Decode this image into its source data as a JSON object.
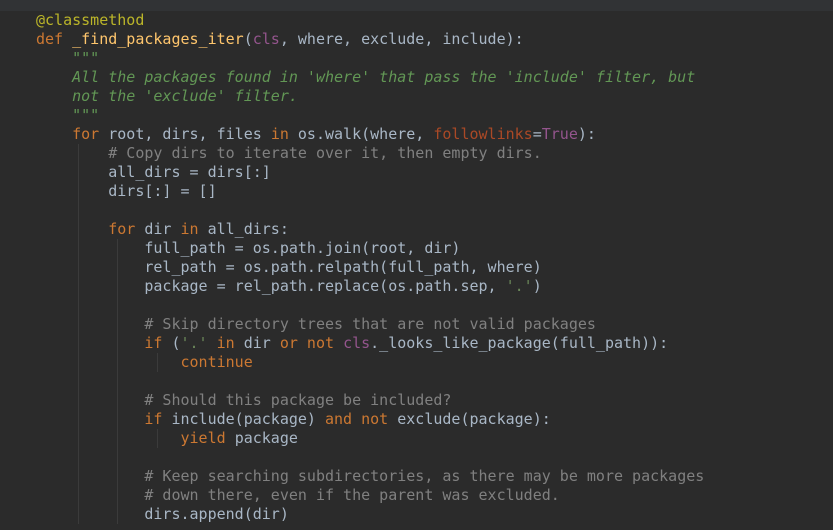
{
  "editor": {
    "theme_colors": {
      "background": "#2b2b2b",
      "keyword": "#cc7832",
      "function": "#ffc66d",
      "decorator": "#bbb529",
      "docstring": "#629755",
      "comment": "#808080",
      "string": "#6a8759",
      "self_param": "#94558d",
      "named_arg": "#aa4926",
      "default_text": "#a9b7c6"
    },
    "lines": [
      {
        "indent": 0,
        "tokens": [
          {
            "t": "deco",
            "v": "@classmethod"
          }
        ]
      },
      {
        "indent": 0,
        "tokens": [
          {
            "t": "kw",
            "v": "def "
          },
          {
            "t": "fn",
            "v": "_find_packages_iter"
          },
          {
            "t": "plain",
            "v": "("
          },
          {
            "t": "self",
            "v": "cls"
          },
          {
            "t": "plain",
            "v": ", where, exclude, include):"
          }
        ]
      },
      {
        "indent": 1,
        "tokens": [
          {
            "t": "doc",
            "v": "\"\"\""
          }
        ]
      },
      {
        "indent": 1,
        "tokens": [
          {
            "t": "doc",
            "v": "All the packages found in 'where' that pass the 'include' filter, but"
          }
        ]
      },
      {
        "indent": 1,
        "tokens": [
          {
            "t": "doc",
            "v": "not the 'exclude' filter."
          }
        ]
      },
      {
        "indent": 1,
        "tokens": [
          {
            "t": "doc",
            "v": "\"\"\""
          }
        ]
      },
      {
        "indent": 1,
        "tokens": [
          {
            "t": "kw",
            "v": "for "
          },
          {
            "t": "plain",
            "v": "root, dirs, files "
          },
          {
            "t": "kw",
            "v": "in "
          },
          {
            "t": "plain",
            "v": "os.walk(where, "
          },
          {
            "t": "param",
            "v": "followlinks"
          },
          {
            "t": "plain",
            "v": "="
          },
          {
            "t": "self",
            "v": "True"
          },
          {
            "t": "plain",
            "v": "):"
          }
        ]
      },
      {
        "indent": 2,
        "tokens": [
          {
            "t": "com",
            "v": "# Copy dirs to iterate over it, then empty dirs."
          }
        ]
      },
      {
        "indent": 2,
        "tokens": [
          {
            "t": "plain",
            "v": "all_dirs = dirs[:]"
          }
        ]
      },
      {
        "indent": 2,
        "tokens": [
          {
            "t": "plain",
            "v": "dirs[:] = []"
          }
        ]
      },
      {
        "indent": 2,
        "tokens": []
      },
      {
        "indent": 2,
        "tokens": [
          {
            "t": "kw",
            "v": "for "
          },
          {
            "t": "plain",
            "v": "dir "
          },
          {
            "t": "kw",
            "v": "in "
          },
          {
            "t": "plain",
            "v": "all_dirs:"
          }
        ]
      },
      {
        "indent": 3,
        "tokens": [
          {
            "t": "plain",
            "v": "full_path = os.path.join(root, dir)"
          }
        ]
      },
      {
        "indent": 3,
        "tokens": [
          {
            "t": "plain",
            "v": "rel_path = os.path.relpath(full_path, where)"
          }
        ]
      },
      {
        "indent": 3,
        "tokens": [
          {
            "t": "plain",
            "v": "package = rel_path.replace(os.path.sep, "
          },
          {
            "t": "str",
            "v": "'.'"
          },
          {
            "t": "plain",
            "v": ")"
          }
        ]
      },
      {
        "indent": 3,
        "tokens": []
      },
      {
        "indent": 3,
        "tokens": [
          {
            "t": "com",
            "v": "# Skip directory trees that are not valid packages"
          }
        ]
      },
      {
        "indent": 3,
        "tokens": [
          {
            "t": "kw",
            "v": "if "
          },
          {
            "t": "plain",
            "v": "("
          },
          {
            "t": "str",
            "v": "'.'"
          },
          {
            "t": "kw",
            "v": " in "
          },
          {
            "t": "plain",
            "v": "dir "
          },
          {
            "t": "kw",
            "v": "or not "
          },
          {
            "t": "self",
            "v": "cls"
          },
          {
            "t": "plain",
            "v": "._looks_like_package(full_path)):"
          }
        ]
      },
      {
        "indent": 4,
        "tokens": [
          {
            "t": "kw",
            "v": "continue"
          }
        ]
      },
      {
        "indent": 3,
        "tokens": []
      },
      {
        "indent": 3,
        "tokens": [
          {
            "t": "com",
            "v": "# Should this package be included?"
          }
        ]
      },
      {
        "indent": 3,
        "tokens": [
          {
            "t": "kw",
            "v": "if "
          },
          {
            "t": "plain",
            "v": "include(package) "
          },
          {
            "t": "kw",
            "v": "and not "
          },
          {
            "t": "plain",
            "v": "exclude(package):"
          }
        ]
      },
      {
        "indent": 4,
        "tokens": [
          {
            "t": "kw",
            "v": "yield "
          },
          {
            "t": "plain",
            "v": "package"
          }
        ]
      },
      {
        "indent": 3,
        "tokens": []
      },
      {
        "indent": 3,
        "tokens": [
          {
            "t": "com",
            "v": "# Keep searching subdirectories, as there may be more packages"
          }
        ]
      },
      {
        "indent": 3,
        "tokens": [
          {
            "t": "com",
            "v": "# down there, even if the parent was excluded."
          }
        ]
      },
      {
        "indent": 3,
        "tokens": [
          {
            "t": "plain",
            "v": "dirs.append(dir)"
          }
        ]
      }
    ]
  }
}
